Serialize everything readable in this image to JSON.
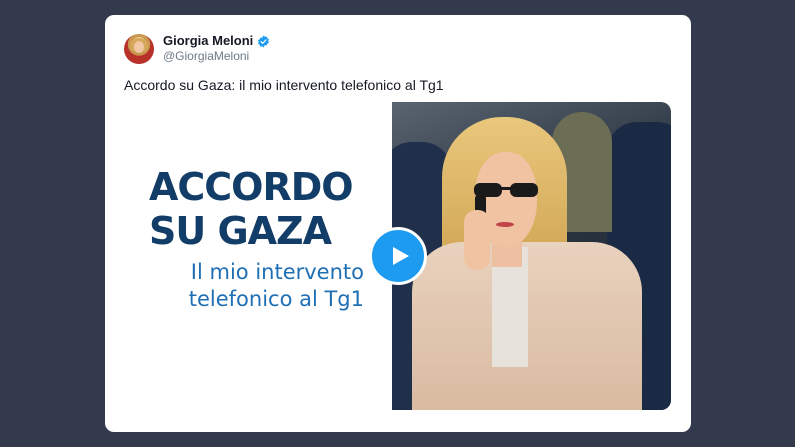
{
  "tweet": {
    "author_name": "Giorgia Meloni",
    "author_handle": "@GiorgiaMeloni",
    "text": "Accordo su Gaza: il mio intervento telefonico al Tg1",
    "verified_color": "#1d9bf0"
  },
  "media": {
    "headline_line1": "ACCORDO",
    "headline_line2": "SU GAZA",
    "subline_line1": "Il mio intervento",
    "subline_line2": "telefonico al Tg1",
    "headline_color": "#123d68",
    "subline_color": "#1f6fb5",
    "play_icon": "play-icon"
  }
}
